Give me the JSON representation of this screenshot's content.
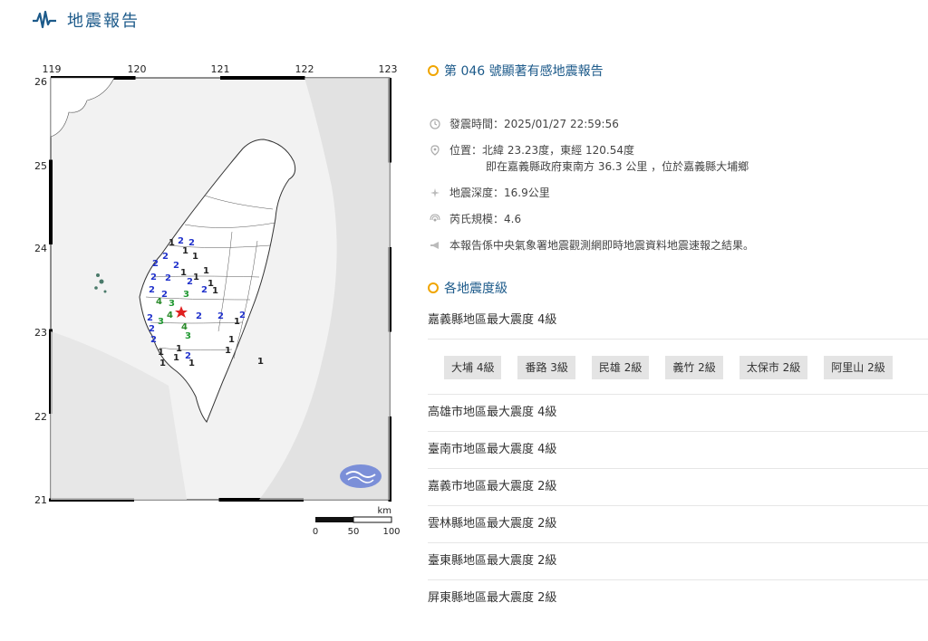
{
  "header": {
    "title": "地震報告",
    "logo_icon": "seismograph-icon"
  },
  "map": {
    "lon_ticks": [
      "119",
      "120",
      "121",
      "122",
      "123"
    ],
    "lat_ticks": [
      "26",
      "25",
      "24",
      "23",
      "22",
      "21"
    ],
    "scale": {
      "unit": "km",
      "labels": [
        "0",
        "50",
        "100"
      ]
    },
    "epicenter_icon": "red-star-icon",
    "agency_logo": "cwa-logo-icon",
    "intensity_markers": [
      {
        "v": "1"
      },
      {
        "v": "2"
      },
      {
        "v": "2"
      },
      {
        "v": "1"
      },
      {
        "v": "2"
      },
      {
        "v": "1"
      },
      {
        "v": "2"
      },
      {
        "v": "2"
      },
      {
        "v": "1"
      },
      {
        "v": "2"
      },
      {
        "v": "1"
      },
      {
        "v": "1"
      },
      {
        "v": "2"
      },
      {
        "v": "2"
      },
      {
        "v": "1"
      },
      {
        "v": "2"
      },
      {
        "v": "3"
      },
      {
        "v": "1"
      },
      {
        "v": "2"
      },
      {
        "v": "2"
      },
      {
        "v": "4"
      },
      {
        "v": "3"
      },
      {
        "v": "4"
      },
      {
        "v": "2"
      },
      {
        "v": "2"
      },
      {
        "v": "2"
      },
      {
        "v": "2"
      },
      {
        "v": "1"
      },
      {
        "v": "2"
      },
      {
        "v": "3"
      },
      {
        "v": "4"
      },
      {
        "v": "2"
      },
      {
        "v": "3"
      },
      {
        "v": "1"
      },
      {
        "v": "1"
      },
      {
        "v": "1"
      },
      {
        "v": "1"
      },
      {
        "v": "1"
      },
      {
        "v": "2"
      },
      {
        "v": "1"
      },
      {
        "v": "1"
      },
      {
        "v": "1"
      }
    ],
    "intensity_colors": {
      "1": "#222222",
      "2": "#2233cc",
      "3": "#229933",
      "4": "#2a8a2a"
    }
  },
  "report": {
    "title": "第 046 號顯著有感地震報告",
    "time_label": "發震時間：2025/01/27 22:59:56",
    "location_label": "位置：北緯 23.23度，東經 120.54度",
    "location_sub": "即在嘉義縣政府東南方 36.3 公里 ，位於嘉義縣大埔鄉",
    "depth_label": "地震深度：16.9公里",
    "magnitude_label": "芮氏規模：4.6",
    "note": "本報告係中央氣象署地震觀測網即時地震資料地震速報之結果。"
  },
  "intensity_section": {
    "title": "各地震度級",
    "regions": [
      {
        "label": "嘉義縣地區最大震度 4級",
        "stations": [
          "大埔 4級",
          "番路 3級",
          "民雄 2級",
          "義竹 2級",
          "太保市 2級",
          "阿里山 2級"
        ]
      },
      {
        "label": "高雄市地區最大震度 4級"
      },
      {
        "label": "臺南市地區最大震度 4級"
      },
      {
        "label": "嘉義市地區最大震度 2級"
      },
      {
        "label": "雲林縣地區最大震度 2級"
      },
      {
        "label": "臺東縣地區最大震度 2級"
      },
      {
        "label": "屏東縣地區最大震度 2級"
      }
    ]
  }
}
